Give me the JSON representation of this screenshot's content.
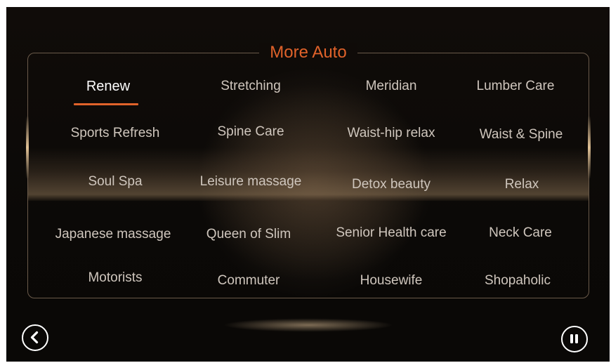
{
  "title": "More Auto",
  "active_program": "Renew",
  "programs": [
    [
      "Renew",
      "Stretching",
      "Meridian",
      "Lumber Care"
    ],
    [
      "Sports Refresh",
      "Spine Care",
      "Waist-hip relax",
      "Waist & Spine"
    ],
    [
      "Soul Spa",
      "Leisure massage",
      "Detox beauty",
      "Relax"
    ],
    [
      "Japanese massage",
      "Queen of Slim",
      "Senior Health care",
      "Neck Care"
    ],
    [
      "Motorists",
      "Commuter",
      "Housewife",
      "Shopaholic"
    ]
  ],
  "icons": {
    "back": "chevron-left-icon",
    "pause": "pause-icon"
  },
  "colors": {
    "accent": "#e0622a",
    "text": "#cfc6bd",
    "active_text": "#ffffff",
    "background": "#0b0907",
    "panel_border": "#6a5a4a"
  }
}
